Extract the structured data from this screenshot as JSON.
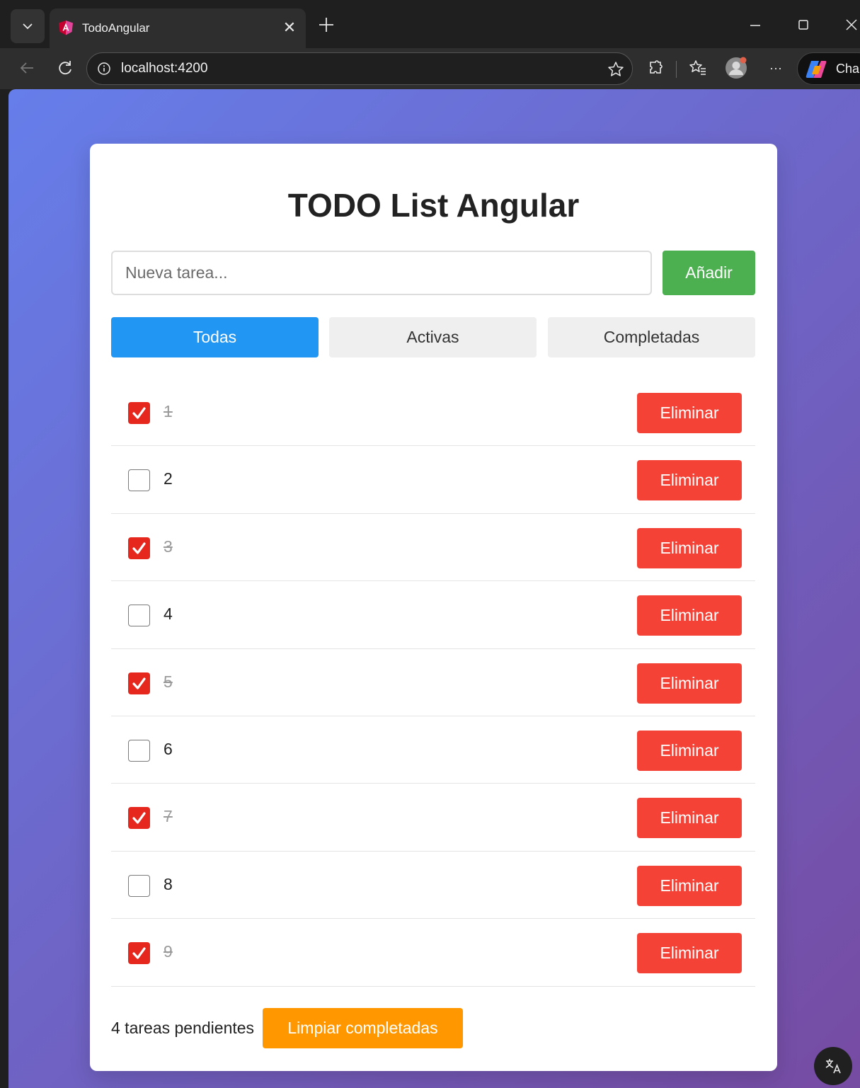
{
  "browser": {
    "tab_title": "TodoAngular",
    "url": "localhost:4200",
    "copilot_label": "Cha",
    "more_label": "···"
  },
  "app": {
    "title": "TODO List Angular",
    "input_placeholder": "Nueva tarea...",
    "add_label": "Añadir",
    "filters": [
      {
        "label": "Todas",
        "active": true
      },
      {
        "label": "Activas",
        "active": false
      },
      {
        "label": "Completadas",
        "active": false
      }
    ],
    "todos": [
      {
        "text": "1",
        "completed": true,
        "delete_label": "Eliminar"
      },
      {
        "text": "2",
        "completed": false,
        "delete_label": "Eliminar"
      },
      {
        "text": "3",
        "completed": true,
        "delete_label": "Eliminar"
      },
      {
        "text": "4",
        "completed": false,
        "delete_label": "Eliminar"
      },
      {
        "text": "5",
        "completed": true,
        "delete_label": "Eliminar"
      },
      {
        "text": "6",
        "completed": false,
        "delete_label": "Eliminar"
      },
      {
        "text": "7",
        "completed": true,
        "delete_label": "Eliminar"
      },
      {
        "text": "8",
        "completed": false,
        "delete_label": "Eliminar"
      },
      {
        "text": "9",
        "completed": true,
        "delete_label": "Eliminar"
      }
    ],
    "pending_text": "4 tareas pendientes",
    "clear_label": "Limpiar completadas"
  },
  "colors": {
    "gradient_start": "#667eea",
    "gradient_end": "#764ba2",
    "add_button": "#4caf50",
    "active_filter": "#2196f3",
    "delete_button": "#f44336",
    "clear_button": "#ff9800",
    "checkbox_checked": "#e5271d"
  }
}
